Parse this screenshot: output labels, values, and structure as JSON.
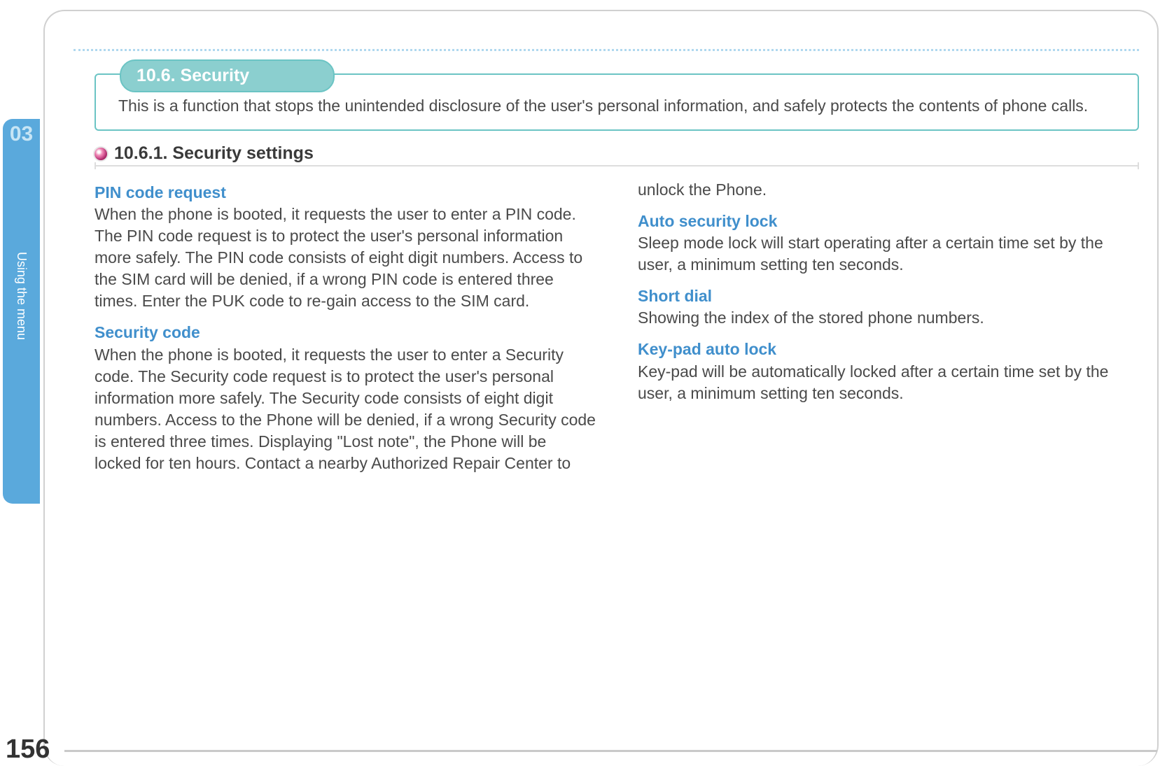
{
  "chapter": "03",
  "sideLabel": "Using the menu",
  "pageNumber": "156",
  "section": {
    "pillTitle": "10.6. Security",
    "description": "This is a function that stops the unintended disclosure of the user's personal information, and safely protects the contents of phone calls."
  },
  "subsection": {
    "title": "10.6.1. Security settings"
  },
  "col1": {
    "h1": "PIN code request",
    "p1": "When the phone is booted, it requests the user to enter a PIN code. The PIN code request is to protect the user's personal information more safely. The PIN code consists of eight digit numbers. Access to the SIM card will be denied, if a wrong PIN code is entered three times. Enter the PUK code to re-gain access to the SIM card.",
    "h2": "Security code",
    "p2": "When the phone is booted, it requests the user to enter a Security code. The Security code request is to protect the user's personal information more safely. The Security code consists of eight digit numbers. Access to the Phone will be denied, if a wrong Security code is entered three times. Displaying \"Lost note\", the Phone will be locked for ten hours. Contact a nearby Authorized Repair Center to"
  },
  "col2": {
    "cont": "unlock the Phone.",
    "h1": "Auto security lock",
    "p1": "Sleep mode lock will start operating after a certain time set by the user, a minimum setting ten seconds.",
    "h2": "Short dial",
    "p2": "Showing the index of the stored phone numbers.",
    "h3": "Key-pad auto lock",
    "p3": "Key-pad will be automatically locked after a certain time set by the user, a minimum setting ten seconds."
  }
}
